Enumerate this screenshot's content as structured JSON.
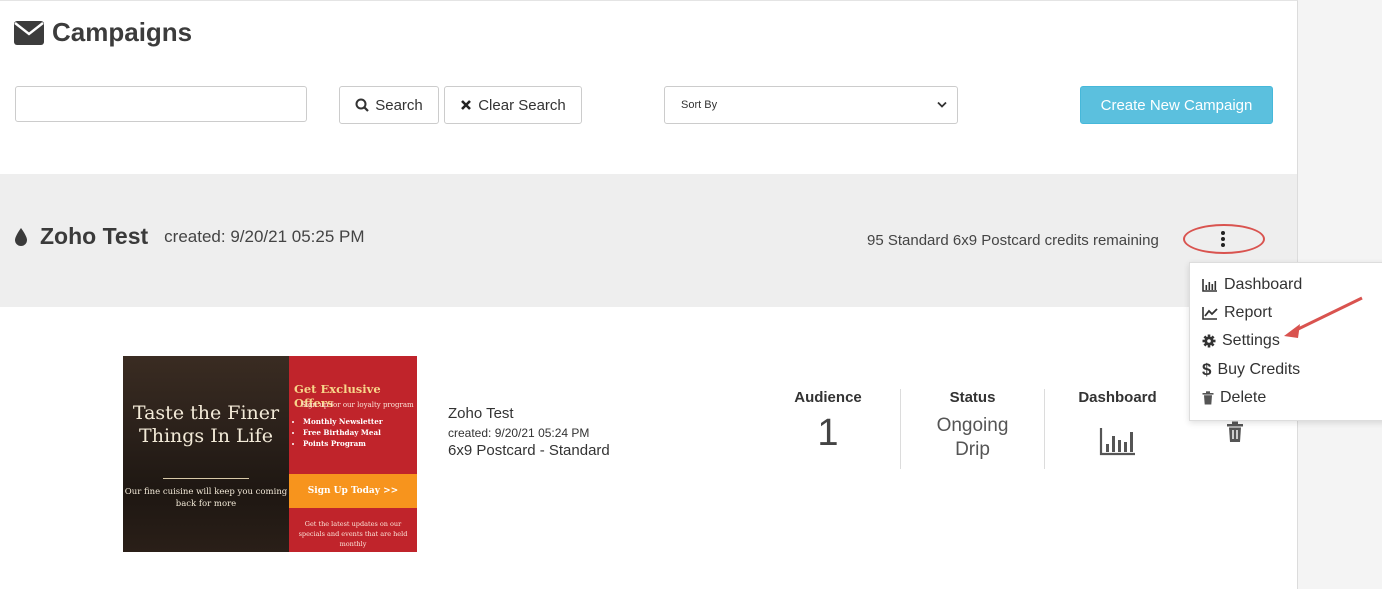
{
  "page": {
    "title": "Campaigns",
    "title_icon": "envelope-icon"
  },
  "toolbar": {
    "search_value": "",
    "search_placeholder": "",
    "search_label": "Search",
    "clear_label": "Clear Search",
    "sort_label": "Sort By",
    "create_label": "Create New Campaign"
  },
  "campaign": {
    "name": "Zoho Test",
    "created": "created: 9/20/21 05:25 PM",
    "credits": "95 Standard 6x9 Postcard credits remaining",
    "menu": [
      {
        "label": "Dashboard",
        "icon": "bar-chart-icon"
      },
      {
        "label": "Report",
        "icon": "line-chart-icon"
      },
      {
        "label": "Settings",
        "icon": "gear-icon"
      },
      {
        "label": "Buy Credits",
        "icon": "dollar-icon"
      },
      {
        "label": "Delete",
        "icon": "trash-icon"
      }
    ],
    "item": {
      "name": "Zoho Test",
      "created": "created: 9/20/21 05:24 PM",
      "type": "6x9 Postcard - Standard",
      "audience_label": "Audience",
      "audience_value": "1",
      "status_label": "Status",
      "status_line1": "Ongoing",
      "status_line2": "Drip",
      "dashboard_label": "Dashboard"
    },
    "postcard": {
      "headline": "Taste the Finer Things In Life",
      "tagline": "Our fine cuisine will keep you coming back for more",
      "offer_title": "Get Exclusive Offers",
      "offer_sub": "Sign up for our loyalty program",
      "bullets": [
        "Monthly Newsletter",
        "Free Birthday Meal",
        "Points Program"
      ],
      "cta": "Sign Up Today >>",
      "footer": "Get the latest updates on our specials and events that are held monthly"
    }
  },
  "colors": {
    "accent": "#5bc0de",
    "highlight": "#d9534f"
  }
}
